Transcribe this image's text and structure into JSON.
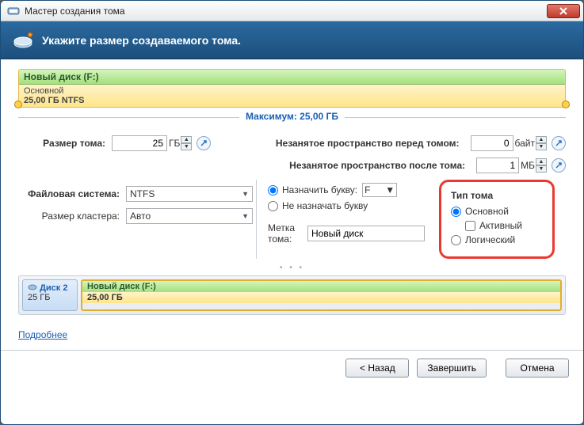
{
  "window": {
    "title": "Мастер создания тома"
  },
  "banner": {
    "text": "Укажите размер создаваемого тома."
  },
  "volume": {
    "name": "Новый диск (F:)",
    "type_line": "Основной",
    "size_line": "25,00 ГБ NTFS",
    "maximum": "Максимум: 25,00 ГБ"
  },
  "fields": {
    "volumeSize": {
      "label": "Размер тома:",
      "value": "25",
      "unit": "ГБ"
    },
    "spaceBefore": {
      "label": "Незанятое пространство перед томом:",
      "value": "0",
      "unit": "байт"
    },
    "spaceAfter": {
      "label": "Незанятое пространство после тома:",
      "value": "1",
      "unit": "МБ"
    },
    "fileSystem": {
      "label": "Файловая система:",
      "value": "NTFS"
    },
    "clusterSize": {
      "label": "Размер кластера:",
      "value": "Авто"
    },
    "assignLetter": {
      "label": "Назначить букву:",
      "value": "F"
    },
    "noLetter": {
      "label": "Не назначать букву"
    },
    "volumeLabel": {
      "label": "Метка тома:",
      "value": "Новый диск"
    }
  },
  "volumeType": {
    "header": "Тип тома",
    "primary": "Основной",
    "active": "Активный",
    "logical": "Логический"
  },
  "disk": {
    "name": "Диск 2",
    "size": "25 ГБ",
    "volName": "Новый диск (F:)",
    "volSize": "25,00 ГБ"
  },
  "more": "Подробнее",
  "buttons": {
    "back": "< Назад",
    "finish": "Завершить",
    "cancel": "Отмена"
  }
}
